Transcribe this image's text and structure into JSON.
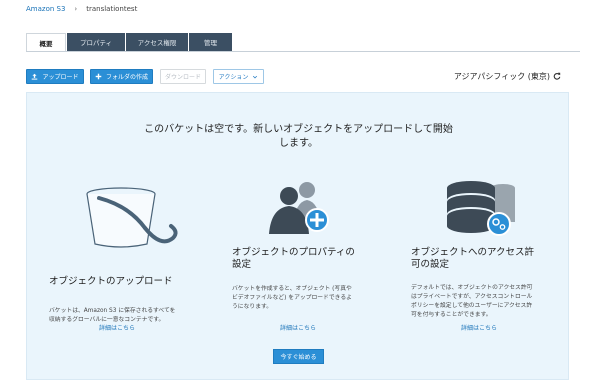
{
  "breadcrumb": {
    "root": "Amazon S3",
    "separator": "›",
    "current": "translationtest"
  },
  "tabs": [
    {
      "label": "概要",
      "active": true
    },
    {
      "label": "プロパティ",
      "active": false
    },
    {
      "label": "アクセス権限",
      "active": false
    },
    {
      "label": "管理",
      "active": false
    }
  ],
  "toolbar": {
    "upload_label": "アップロード",
    "create_folder_label": "フォルダの作成",
    "download_label": "ダウンロード",
    "actions_label": "アクション"
  },
  "region": {
    "label": "アジアパシフィック (東京)"
  },
  "empty_state": {
    "headline_line1": "このバケットは空です。新しいオブジェクトをアップロードして開始",
    "headline_line2": "します。",
    "columns": [
      {
        "title": "オブジェクトのアップロード",
        "desc_line1": "バケットは、Amazon S3 に保存されるすべてを",
        "desc_line2": "収納するグローバルに一意なコンテナです。",
        "desc_line3": "",
        "desc_line4": "",
        "link": "詳細はこちら"
      },
      {
        "title_line1": "オブジェクトのプロパティの",
        "title_line2": "設定",
        "desc_line1": "バケットを作成すると、オブジェクト (写真や",
        "desc_line2": "ビデオファイルなど) をアップロードできるよ",
        "desc_line3": "うになります。",
        "link": "詳細はこちら"
      },
      {
        "title_line1": "オブジェクトへのアクセス許",
        "title_line2": "可の設定",
        "desc_line1": "デフォルトでは、オブジェクトのアクセス許可",
        "desc_line2": "はプライベートですが、アクセスコントロール",
        "desc_line3": "ポリシーを設定して他のユーザーにアクセス許",
        "desc_line4": "可を付与することができます。",
        "link": "詳細はこちら"
      }
    ],
    "start_button": "今すぐ始める"
  },
  "colors": {
    "primary": "#2b8fd6",
    "tab_dark": "#3b4f63",
    "panel_bg": "#eaf5fc",
    "link": "#1a73b8"
  }
}
